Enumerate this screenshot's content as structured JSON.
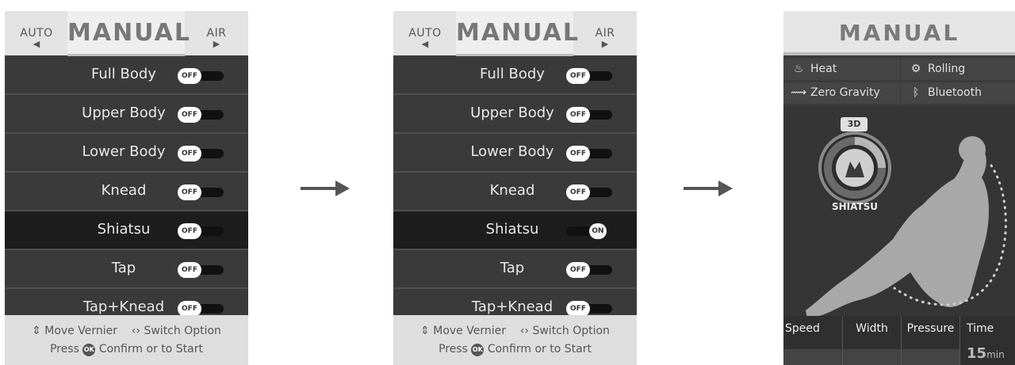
{
  "panel_a": {
    "tabs": {
      "left": "AUTO",
      "center": "MANUAL",
      "right": "AIR"
    },
    "rows": [
      {
        "label": "Full Body",
        "toggle": "OFF"
      },
      {
        "label": "Upper Body",
        "toggle": "OFF"
      },
      {
        "label": "Lower Body",
        "toggle": "OFF"
      },
      {
        "label": "Knead",
        "toggle": "OFF"
      },
      {
        "label": "Shiatsu",
        "toggle": "OFF"
      },
      {
        "label": "Tap",
        "toggle": "OFF"
      },
      {
        "label": "Tap+Knead",
        "toggle": "OFF"
      }
    ],
    "footer": {
      "move": "Move Vernier",
      "switch": "Switch Option",
      "press": "Press",
      "ok": "OK",
      "confirm": "Confirm or to Start"
    }
  },
  "panel_b": {
    "tabs": {
      "left": "AUTO",
      "center": "MANUAL",
      "right": "AIR"
    },
    "rows": [
      {
        "label": "Full Body",
        "toggle": "OFF"
      },
      {
        "label": "Upper Body",
        "toggle": "OFF"
      },
      {
        "label": "Lower Body",
        "toggle": "OFF"
      },
      {
        "label": "Knead",
        "toggle": "OFF"
      },
      {
        "label": "Shiatsu",
        "toggle": "ON"
      },
      {
        "label": "Tap",
        "toggle": "OFF"
      },
      {
        "label": "Tap+Knead",
        "toggle": "OFF"
      }
    ],
    "footer": {
      "move": "Move Vernier",
      "switch": "Switch Option",
      "press": "Press",
      "ok": "OK",
      "confirm": "Confirm or to Start"
    }
  },
  "panel_c": {
    "title": "MANUAL",
    "features": {
      "heat": "Heat",
      "rolling": "Rolling",
      "zero_gravity": "Zero Gravity",
      "bluetooth": "Bluetooth"
    },
    "mode_badge": "3D",
    "mode_label": "SHIATSU",
    "metrics": {
      "speed": "Speed",
      "width": "Width",
      "pressure": "Pressure",
      "time": "Time"
    },
    "time_value": "15",
    "time_unit": "min"
  },
  "colors": {
    "panel_bg": "#3a3a3a",
    "selected_row": "#1d1d1d",
    "tab_bg": "#e3e3e3",
    "footer_bg": "#dedede"
  }
}
